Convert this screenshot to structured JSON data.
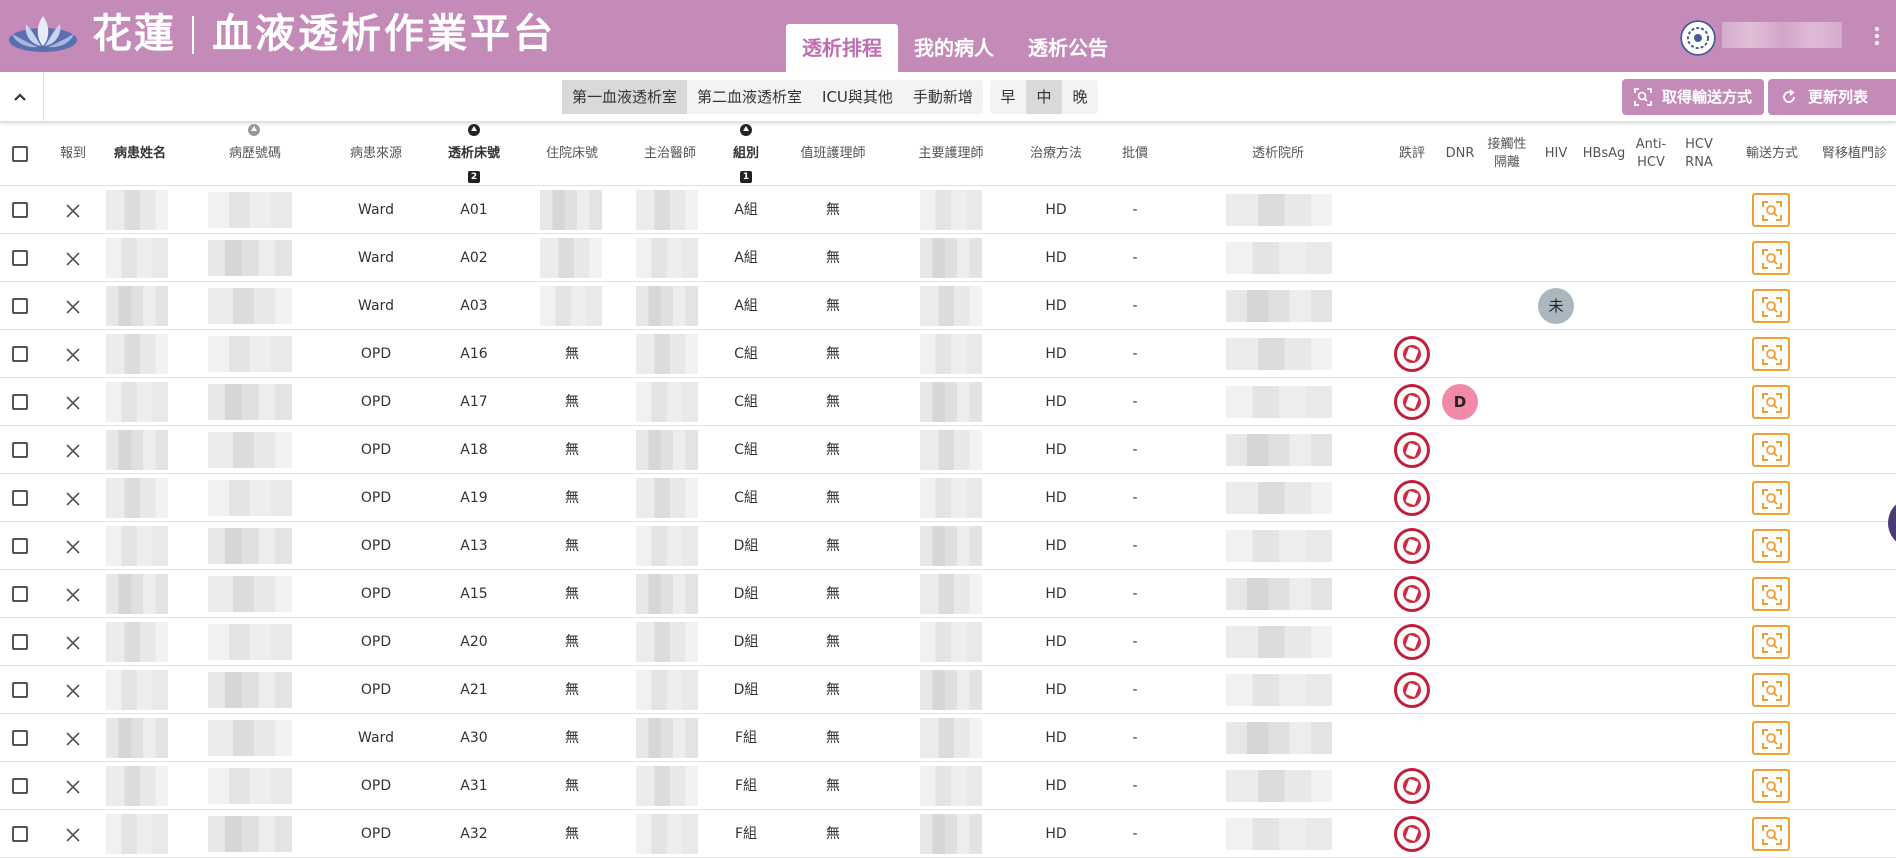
{
  "header": {
    "brand": "花蓮",
    "platform_title": "血液透析作業平台",
    "tabs": [
      {
        "label": "透析排程",
        "active": true
      },
      {
        "label": "我的病人",
        "active": false
      },
      {
        "label": "透析公告",
        "active": false
      }
    ],
    "accent_color": "#c48bb8"
  },
  "toolbar": {
    "rooms": [
      {
        "label": "第一血液透析室",
        "active": true
      },
      {
        "label": "第二血液透析室",
        "active": false
      },
      {
        "label": "ICU與其他",
        "active": false
      },
      {
        "label": "手動新增",
        "active": false
      }
    ],
    "shifts": [
      {
        "label": "早",
        "active": false
      },
      {
        "label": "中",
        "active": true
      },
      {
        "label": "晚",
        "active": false
      }
    ],
    "get_transport_label": "取得輸送方式",
    "refresh_label": "更新列表"
  },
  "table": {
    "columns": {
      "report": "報到",
      "patient_name": "病患姓名",
      "chart_no": "病歷號碼",
      "source": "病患來源",
      "bed": "透析床號",
      "ward_bed": "住院床號",
      "doctor": "主治醫師",
      "group": "組別",
      "duty_nurse": "值班護理師",
      "primary_nurse": "主要護理師",
      "treatment": "治療方法",
      "billing": "批價",
      "hospital": "透析院所",
      "fall": "跌評",
      "dnr": "DNR",
      "isolation": "接觸性隔離",
      "hiv": "HIV",
      "hbsag": "HBsAg",
      "anti_hcv": "Anti-HCV",
      "hcv_rna": "HCV RNA",
      "transport": "輸送方式",
      "transplant": "腎移植門診"
    },
    "sort_badges": {
      "bed": "2",
      "group": "1"
    },
    "rows": [
      {
        "source": "Ward",
        "bed": "A01",
        "ward_bed": "",
        "group": "A組",
        "duty": "無",
        "treatment": "HD",
        "billing": "-",
        "fall": false,
        "dnr": "",
        "hiv": ""
      },
      {
        "source": "Ward",
        "bed": "A02",
        "ward_bed": "",
        "group": "A組",
        "duty": "無",
        "treatment": "HD",
        "billing": "-",
        "fall": false,
        "dnr": "",
        "hiv": ""
      },
      {
        "source": "Ward",
        "bed": "A03",
        "ward_bed": "",
        "group": "A組",
        "duty": "無",
        "treatment": "HD",
        "billing": "-",
        "fall": false,
        "dnr": "",
        "hiv": "未"
      },
      {
        "source": "OPD",
        "bed": "A16",
        "ward_bed": "無",
        "group": "C組",
        "duty": "無",
        "treatment": "HD",
        "billing": "-",
        "fall": true,
        "dnr": "",
        "hiv": ""
      },
      {
        "source": "OPD",
        "bed": "A17",
        "ward_bed": "無",
        "group": "C組",
        "duty": "無",
        "treatment": "HD",
        "billing": "-",
        "fall": true,
        "dnr": "D",
        "hiv": ""
      },
      {
        "source": "OPD",
        "bed": "A18",
        "ward_bed": "無",
        "group": "C組",
        "duty": "無",
        "treatment": "HD",
        "billing": "-",
        "fall": true,
        "dnr": "",
        "hiv": ""
      },
      {
        "source": "OPD",
        "bed": "A19",
        "ward_bed": "無",
        "group": "C組",
        "duty": "無",
        "treatment": "HD",
        "billing": "-",
        "fall": true,
        "dnr": "",
        "hiv": ""
      },
      {
        "source": "OPD",
        "bed": "A13",
        "ward_bed": "無",
        "group": "D組",
        "duty": "無",
        "treatment": "HD",
        "billing": "-",
        "fall": true,
        "dnr": "",
        "hiv": ""
      },
      {
        "source": "OPD",
        "bed": "A15",
        "ward_bed": "無",
        "group": "D組",
        "duty": "無",
        "treatment": "HD",
        "billing": "-",
        "fall": true,
        "dnr": "",
        "hiv": ""
      },
      {
        "source": "OPD",
        "bed": "A20",
        "ward_bed": "無",
        "group": "D組",
        "duty": "無",
        "treatment": "HD",
        "billing": "-",
        "fall": true,
        "dnr": "",
        "hiv": ""
      },
      {
        "source": "OPD",
        "bed": "A21",
        "ward_bed": "無",
        "group": "D組",
        "duty": "無",
        "treatment": "HD",
        "billing": "-",
        "fall": true,
        "dnr": "",
        "hiv": ""
      },
      {
        "source": "Ward",
        "bed": "A30",
        "ward_bed": "無",
        "group": "F組",
        "duty": "無",
        "treatment": "HD",
        "billing": "-",
        "fall": false,
        "dnr": "",
        "hiv": ""
      },
      {
        "source": "OPD",
        "bed": "A31",
        "ward_bed": "無",
        "group": "F組",
        "duty": "無",
        "treatment": "HD",
        "billing": "-",
        "fall": true,
        "dnr": "",
        "hiv": ""
      },
      {
        "source": "OPD",
        "bed": "A32",
        "ward_bed": "無",
        "group": "F組",
        "duty": "無",
        "treatment": "HD",
        "billing": "-",
        "fall": true,
        "dnr": "",
        "hiv": ""
      }
    ]
  }
}
